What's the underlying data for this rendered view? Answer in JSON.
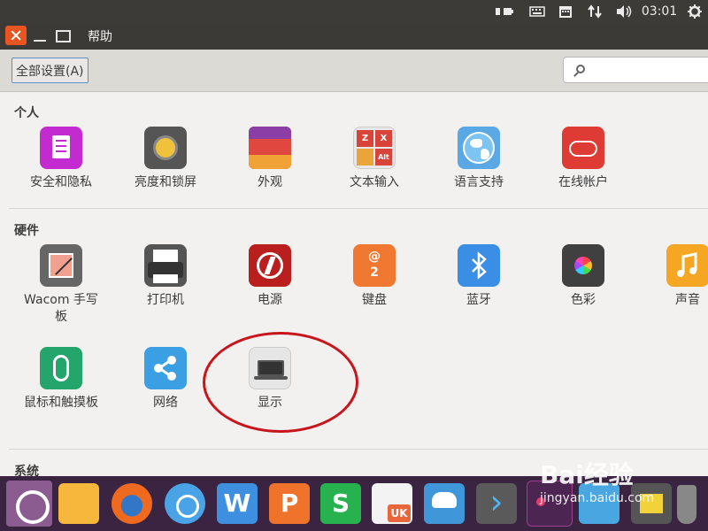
{
  "topbar": {
    "clock": "03:01",
    "indicators": [
      "battery-icon",
      "keyboard-icon",
      "calendar-icon",
      "network-arrows-icon",
      "volume-icon",
      "settings-gear-icon"
    ]
  },
  "window": {
    "menu_help": "帮助"
  },
  "toolbar": {
    "all_settings": "全部设置(A)",
    "search_placeholder": ""
  },
  "sections": {
    "personal": {
      "title": "个人",
      "items": [
        {
          "label": "安全和隐私",
          "icon": "privacy-icon"
        },
        {
          "label": "亮度和锁屏",
          "icon": "brightness-lock-icon"
        },
        {
          "label": "外观",
          "icon": "appearance-icon"
        },
        {
          "label": "文本输入",
          "icon": "text-entry-icon"
        },
        {
          "label": "语言支持",
          "icon": "language-globe-icon"
        },
        {
          "label": "在线帐户",
          "icon": "online-accounts-icon"
        }
      ]
    },
    "hardware": {
      "title": "硬件",
      "items": [
        {
          "label": "Wacom 手写板",
          "icon": "wacom-tablet-icon"
        },
        {
          "label": "打印机",
          "icon": "printer-icon"
        },
        {
          "label": "电源",
          "icon": "power-icon"
        },
        {
          "label": "键盘",
          "icon": "keyboard-icon"
        },
        {
          "label": "蓝牙",
          "icon": "bluetooth-icon"
        },
        {
          "label": "色彩",
          "icon": "color-icon"
        },
        {
          "label": "声音",
          "icon": "sound-icon"
        },
        {
          "label": "鼠标和触摸板",
          "icon": "mouse-icon"
        },
        {
          "label": "网络",
          "icon": "network-icon"
        },
        {
          "label": "显示",
          "icon": "display-icon"
        }
      ]
    },
    "system": {
      "title": "系统"
    }
  },
  "text_entry_keys": [
    "Z",
    "X",
    "",
    "Alt"
  ],
  "keyboard_icon_text": [
    "@",
    "2"
  ],
  "watermark": {
    "brand": "Bai经验",
    "url": "jingyan.baidu.com"
  },
  "colors": {
    "accent": "#e95420",
    "annotation_red": "#c8151c"
  }
}
